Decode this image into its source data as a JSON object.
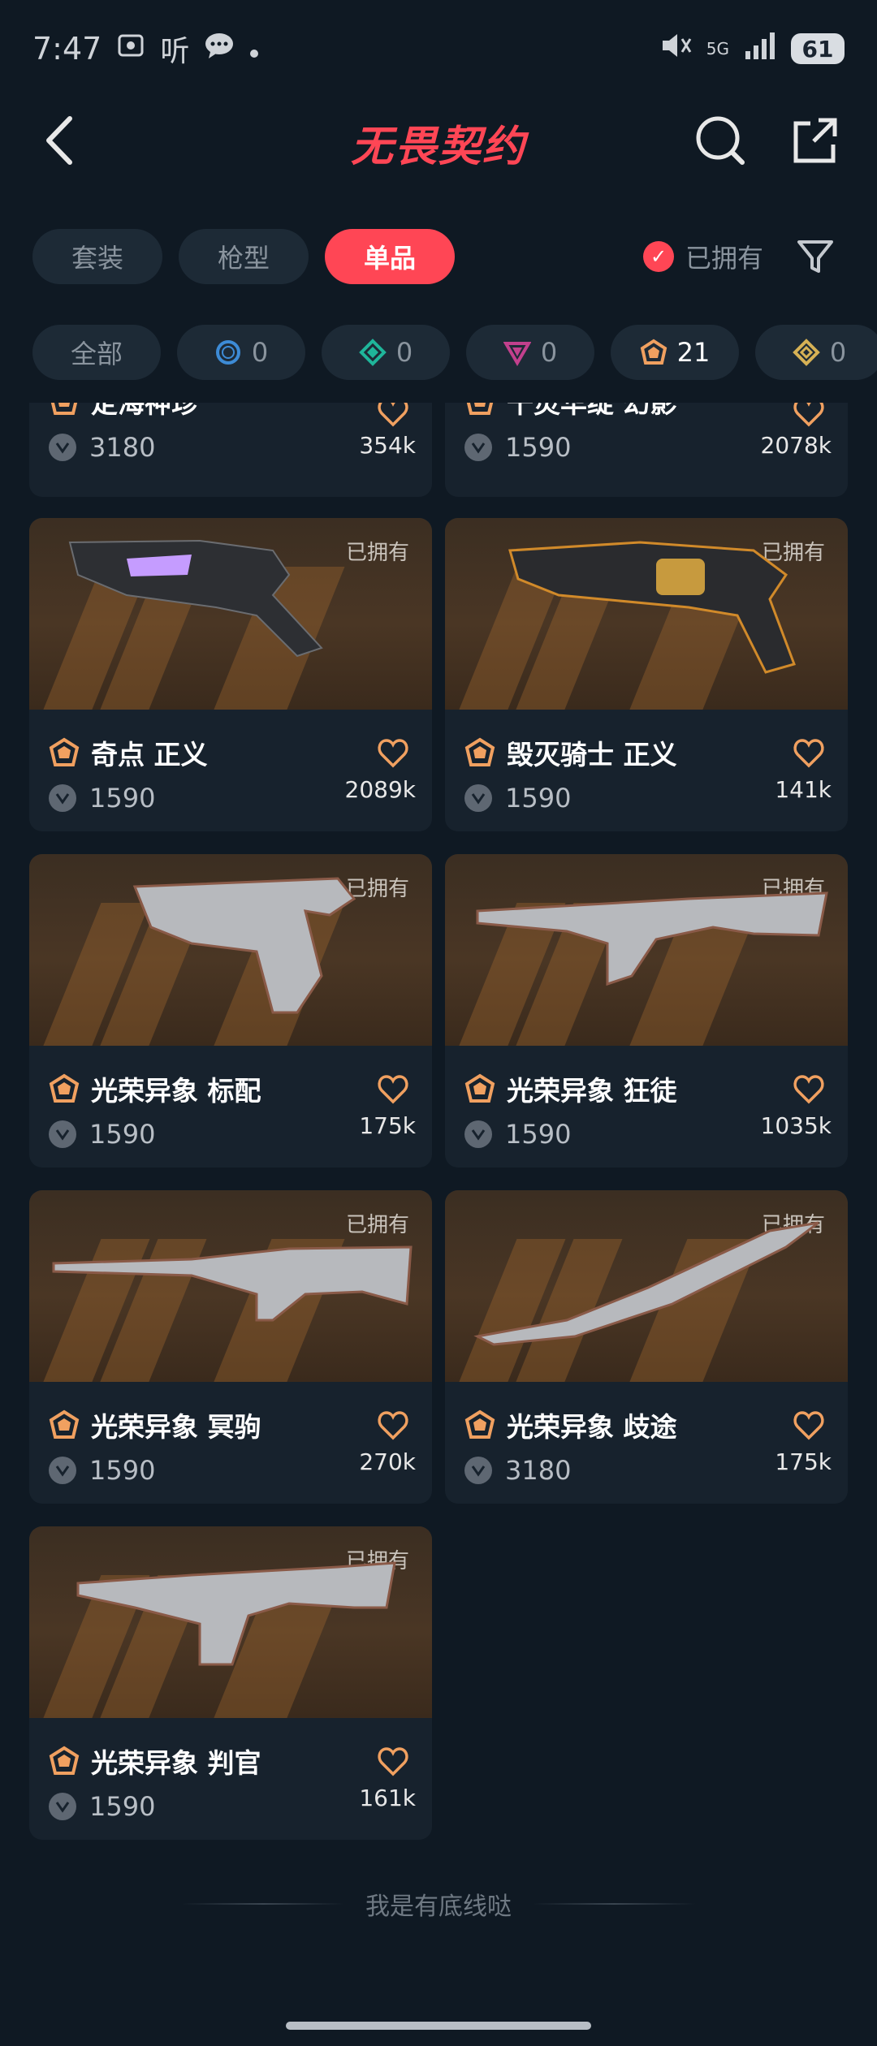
{
  "status_bar": {
    "time": "7:47",
    "icons_left": [
      "screenshot-icon",
      "listen-icon",
      "message-icon"
    ],
    "listen_label": "听",
    "network": "5G",
    "battery": "61"
  },
  "header": {
    "title": "无畏契约",
    "accent": "#ff4655"
  },
  "type_tabs": [
    {
      "label": "套装",
      "active": false
    },
    {
      "label": "枪型",
      "active": false
    },
    {
      "label": "单品",
      "active": true
    }
  ],
  "owned_filter": {
    "label": "已拥有",
    "checked": true
  },
  "tiers": [
    {
      "label": "全部",
      "icon": "all"
    },
    {
      "count": "0",
      "icon": "select-tier-icon",
      "color": "#3d8bd6"
    },
    {
      "count": "0",
      "icon": "deluxe-tier-icon",
      "color": "#1fb59a"
    },
    {
      "count": "0",
      "icon": "premium-tier-icon",
      "color": "#c2408d"
    },
    {
      "count": "21",
      "icon": "exclusive-tier-icon",
      "color": "#f0a060",
      "selected": true
    },
    {
      "count": "0",
      "icon": "ultra-tier-icon",
      "color": "#d6b155"
    }
  ],
  "partial_cards": [
    {
      "name": "定海神珍",
      "price": "3180",
      "count": "354k"
    },
    {
      "name": "千灵华绽 幻影",
      "price": "1590",
      "count": "2078k"
    }
  ],
  "cards": [
    {
      "name": "奇点 正义",
      "price": "1590",
      "count": "2089k",
      "owned": "已拥有"
    },
    {
      "name": "毁灭骑士 正义",
      "price": "1590",
      "count": "141k",
      "owned": "已拥有"
    },
    {
      "name": "光荣异象 标配",
      "price": "1590",
      "count": "175k",
      "owned": "已拥有"
    },
    {
      "name": "光荣异象 狂徒",
      "price": "1590",
      "count": "1035k",
      "owned": "已拥有"
    },
    {
      "name": "光荣异象 冥驹",
      "price": "1590",
      "count": "270k",
      "owned": "已拥有"
    },
    {
      "name": "光荣异象 歧途",
      "price": "3180",
      "count": "175k",
      "owned": "已拥有"
    },
    {
      "name": "光荣异象 判官",
      "price": "1590",
      "count": "161k",
      "owned": "已拥有"
    }
  ],
  "footer": {
    "text": "我是有底线哒"
  }
}
